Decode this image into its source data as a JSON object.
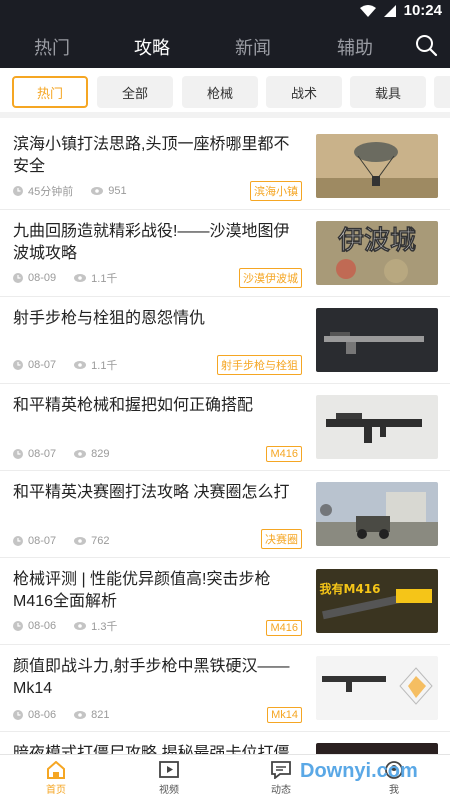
{
  "status_bar": {
    "time": "10:24"
  },
  "top_tabs": [
    {
      "label": "热门",
      "active": false
    },
    {
      "label": "攻略",
      "active": true
    },
    {
      "label": "新闻",
      "active": false
    },
    {
      "label": "辅助",
      "active": false
    }
  ],
  "filters": [
    "热门",
    "全部",
    "枪械",
    "战术",
    "载具"
  ],
  "active_filter": "热门",
  "articles": [
    {
      "title": "滨海小镇打法思路,头顶一座桥哪里都不安全",
      "time": "45分钟前",
      "views": "951",
      "tag": "滨海小镇",
      "thumb": "parachute-in-field"
    },
    {
      "title": "九曲回肠造就精彩战役!——沙漠地图伊波城攻略",
      "time": "08-09",
      "views": "1.1千",
      "tag": "沙漠伊波城",
      "thumb_text": "伊波城"
    },
    {
      "title": "射手步枪与栓狙的恩怨情仇",
      "time": "08-07",
      "views": "1.1千",
      "tag": "射手步枪与栓狙",
      "thumb": "rifle-dark"
    },
    {
      "title": "和平精英枪械和握把如何正确搭配",
      "time": "08-07",
      "views": "829",
      "tag": "M416",
      "thumb": "rifle-light"
    },
    {
      "title": "和平精英决赛圈打法攻略 决赛圈怎么打",
      "time": "08-07",
      "views": "762",
      "tag": "决赛圈",
      "thumb": "vehicle-scene"
    },
    {
      "title": "枪械评测 | 性能优异颜值高!突击步枪M416全面解析",
      "time": "08-06",
      "views": "1.3千",
      "tag": "M416",
      "thumb_text": "我有M416"
    },
    {
      "title": "颜值即战斗力,射手步枪中黑铁硬汉——Mk14",
      "time": "08-06",
      "views": "821",
      "tag": "Mk14",
      "thumb": "mk14-stats"
    },
    {
      "title": "暗夜模式打僵尸攻略 揭秘最强卡位打僵尸点!",
      "time": "",
      "views": "",
      "tag": "",
      "thumb": "dark"
    }
  ],
  "bottom_tabs": [
    {
      "label": "首页",
      "icon": "home-icon",
      "active": true
    },
    {
      "label": "视频",
      "icon": "video-icon",
      "active": false
    },
    {
      "label": "动态",
      "icon": "chat-icon",
      "active": false
    },
    {
      "label": "我",
      "icon": "profile-icon",
      "active": false
    }
  ],
  "watermark": "Downyi.com",
  "colors": {
    "accent": "#f5a623",
    "nav_bg": "#1b1d24"
  }
}
